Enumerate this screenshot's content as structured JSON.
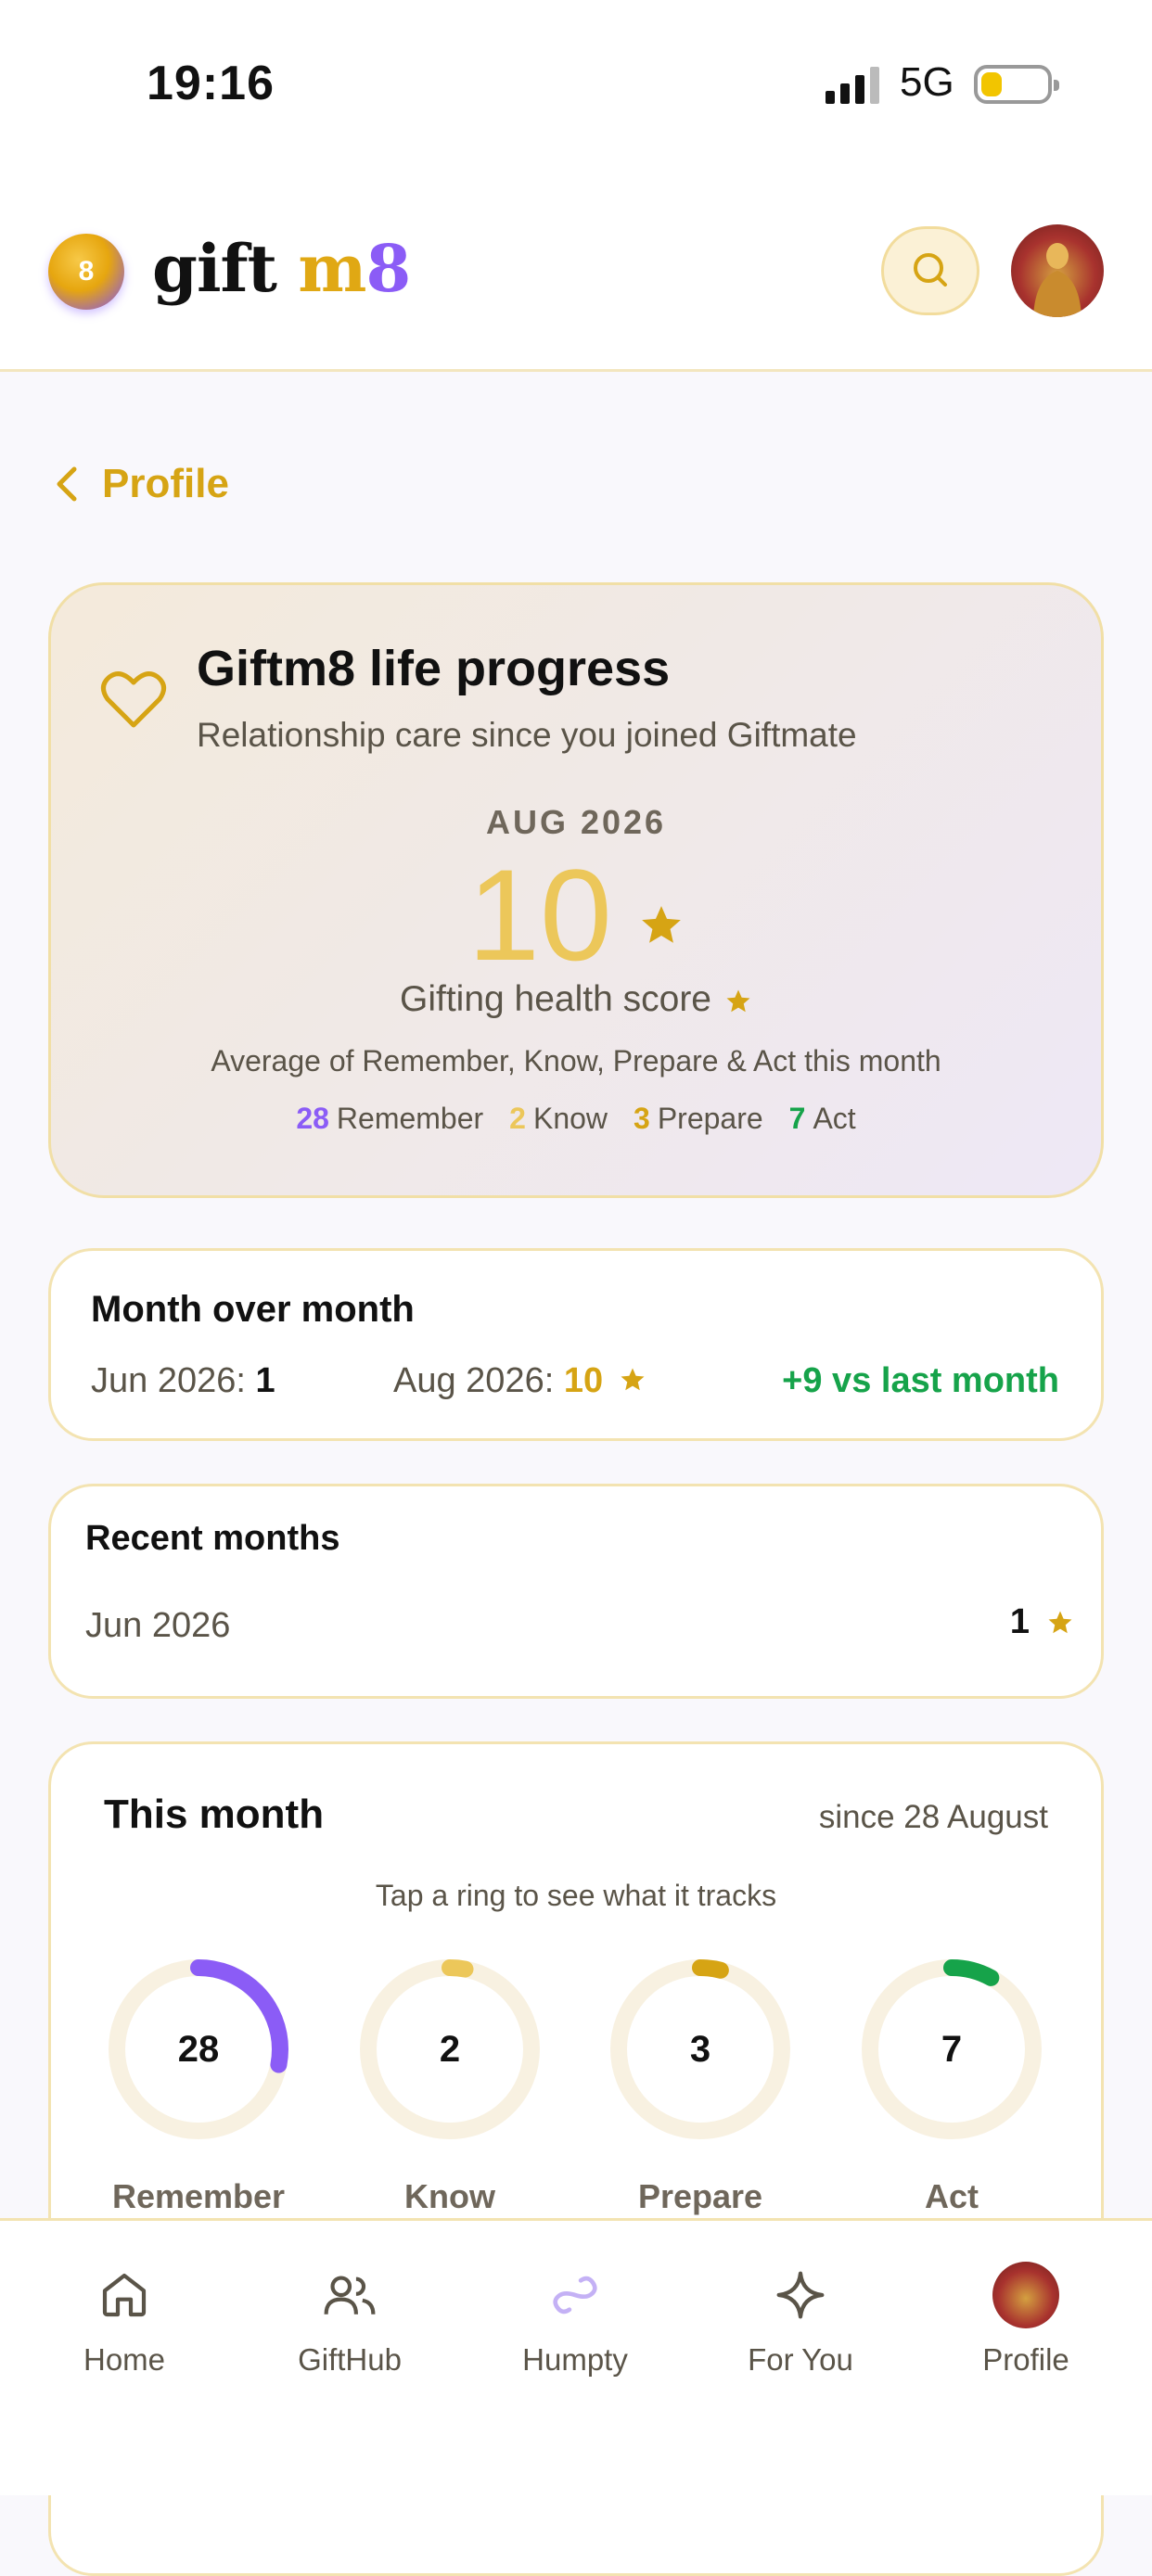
{
  "status_bar": {
    "time": "19:16",
    "network": "5G"
  },
  "header": {
    "brand_gift": "gift",
    "brand_m": "m",
    "brand_8": "8",
    "logo_badge": "8"
  },
  "back": {
    "label": "Profile"
  },
  "progress": {
    "title": "Giftm8 life progress",
    "subtitle": "Relationship care since you joined Giftmate",
    "month": "AUG 2026",
    "score": "10",
    "score_label": "Gifting health score",
    "average_note": "Average of Remember, Know, Prepare & Act this month",
    "legend": [
      {
        "value": "28",
        "label": "Remember",
        "color": "#8b5cf6"
      },
      {
        "value": "2",
        "label": "Know",
        "color": "#ecc75a"
      },
      {
        "value": "3",
        "label": "Prepare",
        "color": "#d6a414"
      },
      {
        "value": "7",
        "label": "Act",
        "color": "#16a34a"
      }
    ]
  },
  "month_over_month": {
    "title": "Month over month",
    "prev_label": "Jun 2026:",
    "prev_value": "1",
    "curr_label": "Aug 2026:",
    "curr_value": "10",
    "diff": "+9 vs last month"
  },
  "recent_months": {
    "title": "Recent months",
    "rows": [
      {
        "month": "Jun 2026",
        "value": "1"
      }
    ]
  },
  "this_month": {
    "title": "This month",
    "since": "since 28 August",
    "hint": "Tap a ring to see what it tracks",
    "rings": [
      {
        "value": "28",
        "label": "Remember",
        "color": "#8b5cf6",
        "fraction": 0.28
      },
      {
        "value": "2",
        "label": "Know",
        "color": "#ecc75a",
        "fraction": 0.03
      },
      {
        "value": "3",
        "label": "Prepare",
        "color": "#d6a414",
        "fraction": 0.04
      },
      {
        "value": "7",
        "label": "Act",
        "color": "#16a34a",
        "fraction": 0.08
      }
    ]
  },
  "nav": [
    {
      "label": "Home",
      "icon": "home-icon"
    },
    {
      "label": "GiftHub",
      "icon": "users-icon"
    },
    {
      "label": "Humpty",
      "icon": "infinity-icon"
    },
    {
      "label": "For You",
      "icon": "sparkle-icon"
    },
    {
      "label": "Profile",
      "icon": "avatar"
    }
  ],
  "colors": {
    "accent_gold": "#d6a414",
    "accent_purple": "#8b5cf6",
    "positive": "#16a34a"
  }
}
